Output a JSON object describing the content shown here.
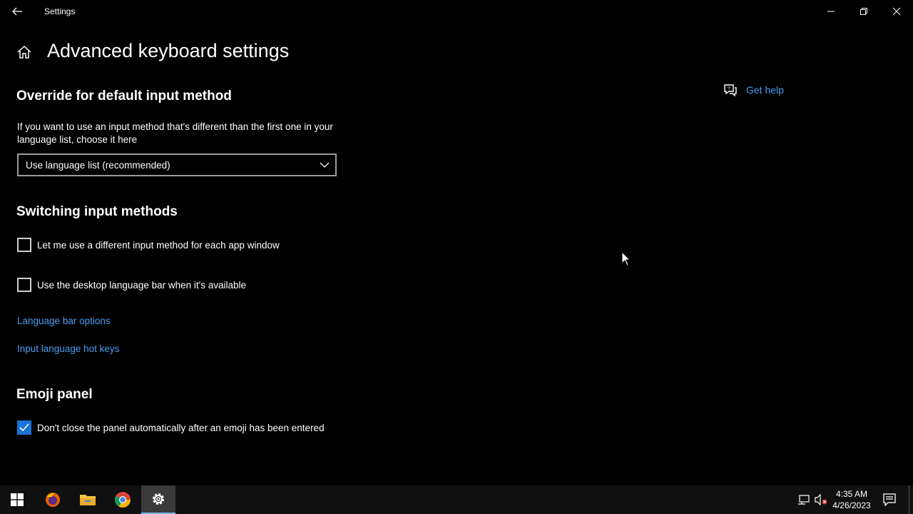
{
  "window": {
    "app_title": "Settings"
  },
  "page": {
    "title": "Advanced keyboard settings",
    "get_help": "Get help"
  },
  "override_section": {
    "heading": "Override for default input method",
    "description": "If you want to use an input method that's different than the first one in your language list, choose it here",
    "dropdown_value": "Use language list (recommended)"
  },
  "switching_section": {
    "heading": "Switching input methods",
    "option1": {
      "label": "Let me use a different input method for each app window",
      "checked": false
    },
    "option2": {
      "label": "Use the desktop language bar when it's available",
      "checked": false
    },
    "link1": "Language bar options",
    "link2": "Input language hot keys"
  },
  "emoji_section": {
    "heading": "Emoji panel",
    "option1": {
      "label": "Don't close the panel automatically after an emoji has been entered",
      "checked": true
    }
  },
  "taskbar": {
    "apps": [
      "start-icon",
      "firefox-icon",
      "file-explorer-icon",
      "chrome-icon",
      "settings-icon"
    ],
    "active_app": "settings",
    "time": "4:35 AM",
    "date": "4/26/2023"
  },
  "colors": {
    "background": "#000000",
    "link": "#4a9ff0",
    "accent": "#1a73d6",
    "taskbar": "#101010"
  }
}
